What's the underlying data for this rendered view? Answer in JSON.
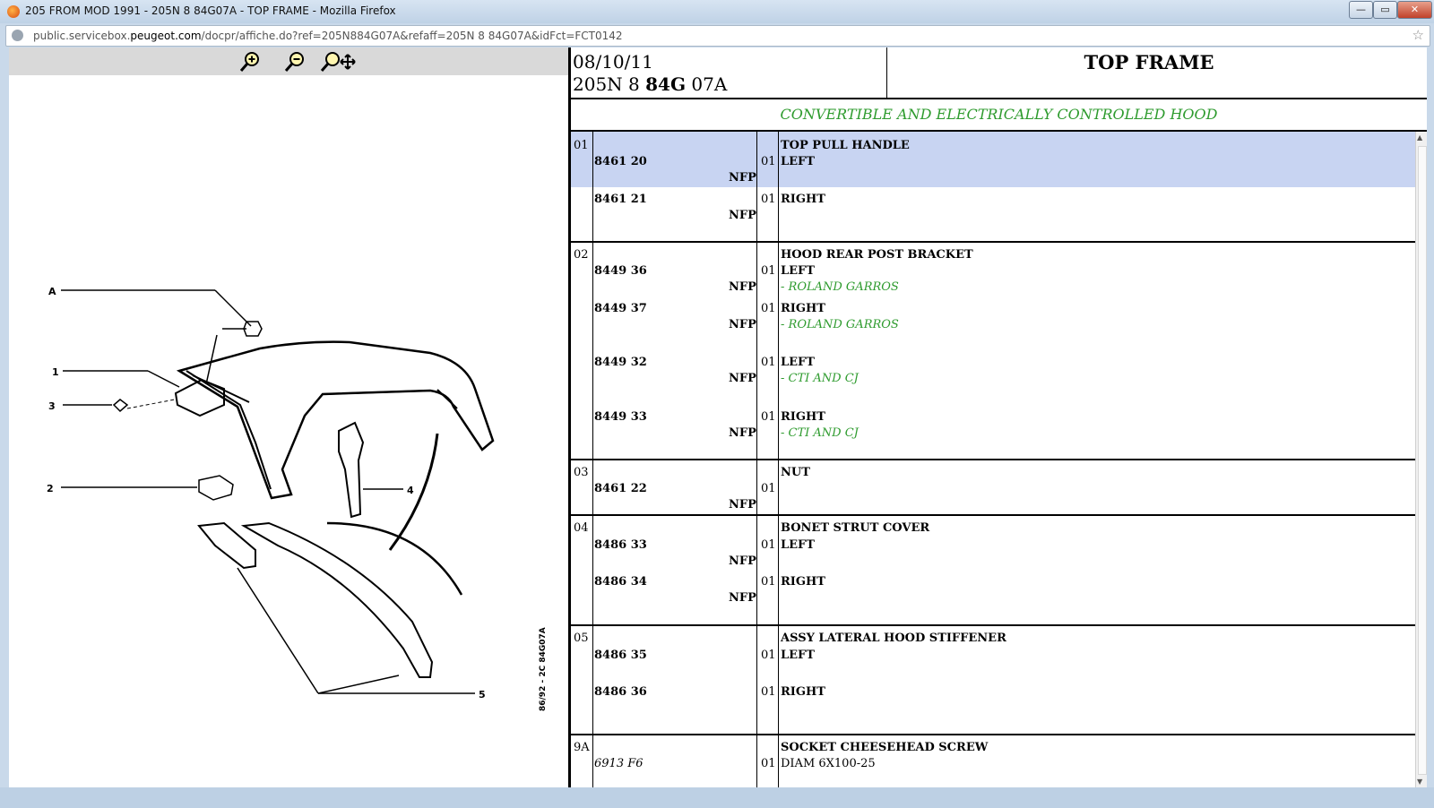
{
  "window": {
    "title": "205 FROM MOD 1991 - 205N 8 84G07A - TOP FRAME - Mozilla Firefox",
    "min_label": "—",
    "max_label": "▭",
    "close_label": "✕"
  },
  "address": {
    "prefix": "public.servicebox.",
    "domain": "peugeot.com",
    "path": "/docpr/affiche.do?ref=205N884G07A&refaff=205N 8 84G07A&idFct=FCT0142"
  },
  "toolbar": {
    "zoom_in": "zoom-in",
    "zoom_out": "zoom-out",
    "zoom_pan": "zoom-pan"
  },
  "diagram": {
    "labels": [
      "A",
      "1",
      "3",
      "2",
      "4",
      "5"
    ],
    "side_code": "86/92 - 2C  84G07A"
  },
  "header": {
    "date": "08/10/11",
    "ref_pre": "205N 8 ",
    "ref_bold": "84G",
    "ref_post": " 07A",
    "title": "TOP FRAME",
    "subtitle": "CONVERTIBLE AND ELECTRICALLY CONTROLLED HOOD"
  },
  "groups": [
    {
      "num": "01",
      "name": "TOP PULL HANDLE",
      "parts": [
        {
          "ref": "8461 20",
          "nfp": "NFP",
          "qty": "01",
          "desc": "LEFT",
          "note": ""
        },
        {
          "ref": "8461 21",
          "nfp": "NFP",
          "qty": "01",
          "desc": "RIGHT",
          "note": ""
        }
      ]
    },
    {
      "num": "02",
      "name": "HOOD REAR POST BRACKET",
      "parts": [
        {
          "ref": "8449 36",
          "nfp": "NFP",
          "qty": "01",
          "desc": "LEFT",
          "note": "- ROLAND GARROS"
        },
        {
          "ref": "8449 37",
          "nfp": "NFP",
          "qty": "01",
          "desc": "RIGHT",
          "note": "- ROLAND GARROS"
        },
        {
          "ref": "8449 32",
          "nfp": "NFP",
          "qty": "01",
          "desc": "LEFT",
          "note": "- CTI AND CJ"
        },
        {
          "ref": "8449 33",
          "nfp": "NFP",
          "qty": "01",
          "desc": "RIGHT",
          "note": "- CTI AND CJ"
        }
      ]
    },
    {
      "num": "03",
      "name": "NUT",
      "parts": [
        {
          "ref": "8461 22",
          "nfp": "NFP",
          "qty": "01",
          "desc": "",
          "note": ""
        }
      ]
    },
    {
      "num": "04",
      "name": "BONET STRUT COVER",
      "parts": [
        {
          "ref": "8486 33",
          "nfp": "NFP",
          "qty": "01",
          "desc": "LEFT",
          "note": ""
        },
        {
          "ref": "8486 34",
          "nfp": "NFP",
          "qty": "01",
          "desc": "RIGHT",
          "note": ""
        }
      ]
    },
    {
      "num": "05",
      "name": "ASSY LATERAL HOOD STIFFENER",
      "parts": [
        {
          "ref": "8486 35",
          "nfp": "",
          "qty": "01",
          "desc": "LEFT",
          "note": ""
        },
        {
          "ref": "8486 36",
          "nfp": "",
          "qty": "01",
          "desc": "RIGHT",
          "note": ""
        }
      ]
    },
    {
      "num": "9A",
      "name": "SOCKET CHEESEHEAD SCREW",
      "parts": [
        {
          "ref": "6913 F6",
          "nfp": "",
          "qty": "01",
          "desc": "DIAM 6X100-25",
          "note": ""
        }
      ]
    }
  ],
  "colors": {
    "accent_green": "#2e9b2e",
    "highlight": "#c8d4f2"
  }
}
